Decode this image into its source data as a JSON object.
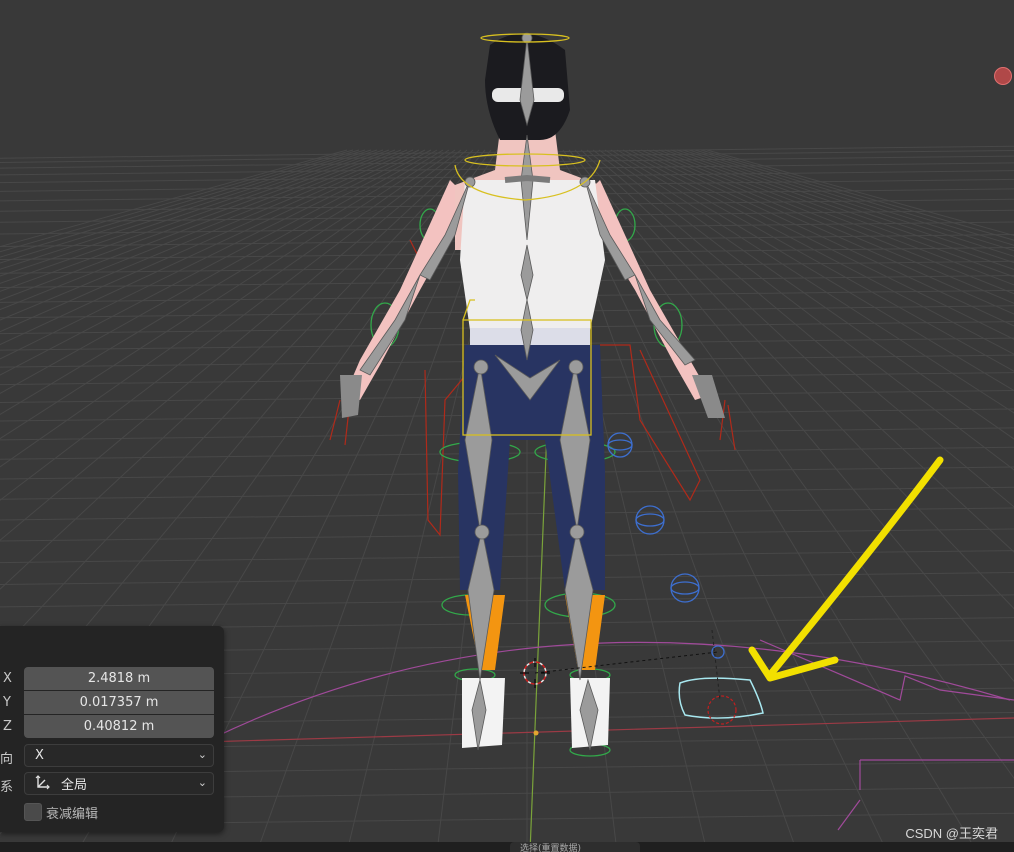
{
  "redo_panel": {
    "location": {
      "x": {
        "label": "X",
        "value": "2.4818 m"
      },
      "y": {
        "label": "Y",
        "value": "0.017357 m"
      },
      "z": {
        "label": "Z",
        "value": "0.40812 m"
      }
    },
    "orient_axis": {
      "label": "向",
      "value": "X"
    },
    "orient_type": {
      "label": "系",
      "value": "全局",
      "icon": "global-orientation-icon"
    },
    "proportional_editing": {
      "label": "衰减编辑",
      "checked": false
    }
  },
  "watermark": "CSDN @王奕君",
  "bottom_tab": "选择(重置数据)",
  "colors": {
    "viewport_bg": "#393939",
    "grid": "#4a4a4a",
    "x_axis": "#9c3a45",
    "y_axis": "#7aa33a",
    "annotation_arrow": "#f2e000"
  }
}
